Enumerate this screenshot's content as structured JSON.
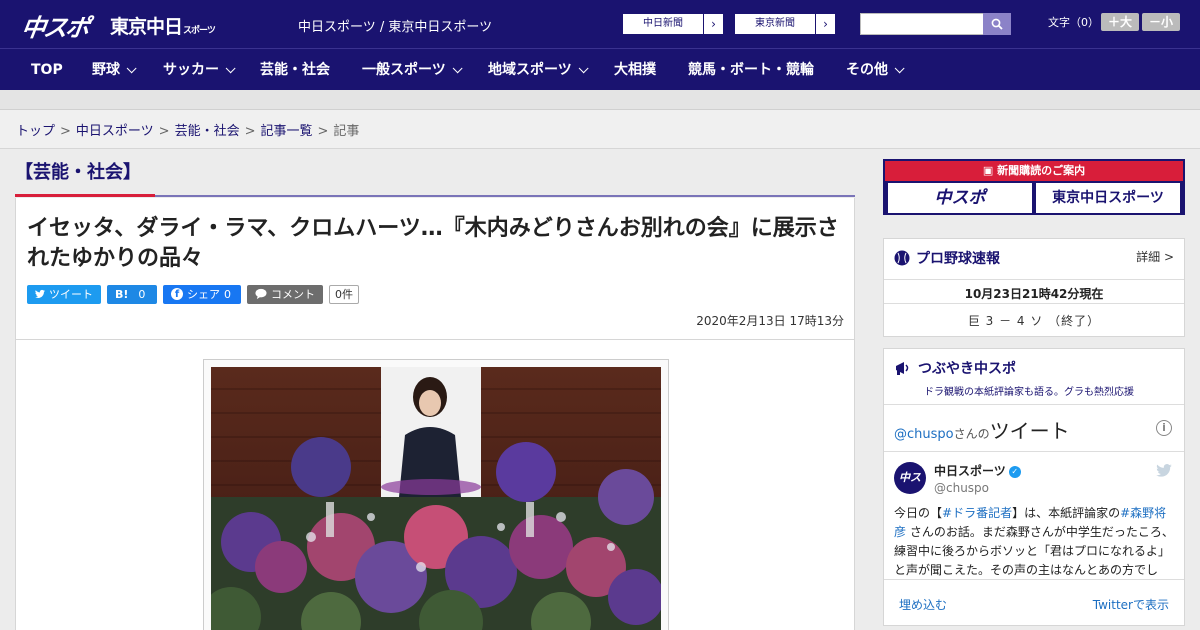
{
  "header": {
    "logo_chuspo": "中スポ",
    "logo_tokyo": "東京中日",
    "logo_tokyo_sub": "スポーツ",
    "site_names": "中日スポーツ / 東京中日スポーツ",
    "ext_links": [
      {
        "label": "中日新聞"
      },
      {
        "label": "東京新聞"
      }
    ],
    "search_placeholder": "",
    "font_size_label": "文字（0）",
    "font_bigger": "＋大",
    "font_smaller": "－小"
  },
  "nav": {
    "items": [
      {
        "label": "TOP",
        "has_menu": false
      },
      {
        "label": "野球",
        "has_menu": true
      },
      {
        "label": "サッカー",
        "has_menu": true
      },
      {
        "label": "芸能・社会",
        "has_menu": false
      },
      {
        "label": "一般スポーツ",
        "has_menu": true
      },
      {
        "label": "地域スポーツ",
        "has_menu": true
      },
      {
        "label": "大相撲",
        "has_menu": false
      },
      {
        "label": "競馬・ボート・競輪",
        "has_menu": false
      },
      {
        "label": "その他",
        "has_menu": true
      }
    ]
  },
  "breadcrumb": {
    "items": [
      "トップ",
      "中日スポーツ",
      "芸能・社会",
      "記事一覧"
    ],
    "current": "記事"
  },
  "article": {
    "category": "【芸能・社会】",
    "headline": "イセッタ、ダライ・ラマ、クロムハーツ…『木内みどりさんお別れの会』に展示されたゆかりの品々",
    "share": {
      "tweet": "ツイート",
      "hatena_label": "B!",
      "hatena_count": "0",
      "facebook": "シェア",
      "facebook_count": "0",
      "comment": "コメント",
      "comment_count": "0件"
    },
    "date": "2020年2月13日 17時13分"
  },
  "sidebar": {
    "promo_title": "新聞購読のご案内",
    "promo_chuspo": "中スポ",
    "promo_tokyo": "東京中日スポーツ",
    "baseball": {
      "title": "プロ野球速報",
      "detail": "詳細 >",
      "time": "10月23日21時42分現在",
      "score": "巨 3 － 4 ソ （終了）"
    },
    "tsubuyaki": {
      "title": "つぶやき中スポ",
      "subtitle": "ドラ観戦の本紙評論家も語る。グラも熱烈応援",
      "handle": "@chuspo",
      "handle_suffix": "さんの",
      "tweets_label": "ツイート",
      "account_name": "中日スポーツ",
      "account_at": "@chuspo",
      "avatar_text": "中スポ",
      "tweet_parts": [
        {
          "text": "今日の【",
          "tag": false
        },
        {
          "text": "#ドラ番記者",
          "tag": true
        },
        {
          "text": "】は、本紙評論家の",
          "tag": false
        },
        {
          "text": "#森野将彦",
          "tag": true
        },
        {
          "text": " さんのお話。まだ森野さんが中学生だったころ、練習中に後ろからボソッと「君はプロになれるよ」と声が聞こえた。その声の主はなんとあの方でし",
          "tag": false
        }
      ],
      "embed": "埋め込む",
      "view_on_twitter": "Twitterで表示"
    }
  },
  "colors": {
    "brand_navy": "#1a1370",
    "accent_red": "#d81e3a",
    "twitter_blue": "#1d9bf0",
    "facebook_blue": "#1877f2"
  }
}
